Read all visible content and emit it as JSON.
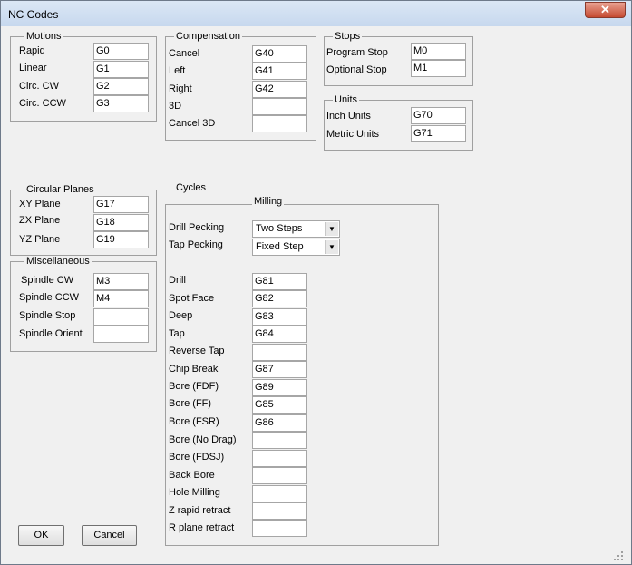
{
  "window": {
    "title": "NC Codes",
    "close_glyph": "✕"
  },
  "groups": {
    "motions": {
      "legend": "Motions",
      "rows": [
        {
          "label": "Rapid",
          "value": "G0"
        },
        {
          "label": "Linear",
          "value": "G1"
        },
        {
          "label": "Circ. CW",
          "value": "G2"
        },
        {
          "label": "Circ. CCW",
          "value": "G3"
        }
      ]
    },
    "compensation": {
      "legend": "Compensation",
      "rows": [
        {
          "label": "Cancel",
          "value": "G40"
        },
        {
          "label": "Left",
          "value": "G41"
        },
        {
          "label": "Right",
          "value": "G42"
        },
        {
          "label": "3D",
          "value": ""
        },
        {
          "label": "Cancel 3D",
          "value": ""
        }
      ]
    },
    "stops": {
      "legend": "Stops",
      "rows": [
        {
          "label": "Program Stop",
          "value": "M0"
        },
        {
          "label": "Optional Stop",
          "value": "M1"
        }
      ]
    },
    "units": {
      "legend": "Units",
      "rows": [
        {
          "label": "Inch Units",
          "value": "G70"
        },
        {
          "label": "Metric Units",
          "value": "G71"
        }
      ]
    },
    "circular_planes": {
      "legend": "Circular Planes",
      "rows": [
        {
          "label": "XY Plane",
          "value": "G17"
        },
        {
          "label": "ZX Plane",
          "value": "G18"
        },
        {
          "label": "YZ Plane",
          "value": "G19"
        }
      ]
    },
    "miscellaneous": {
      "legend": "Miscellaneous",
      "rows": [
        {
          "label": "Spindle CW",
          "value": "M3"
        },
        {
          "label": "Spindle CCW",
          "value": "M4"
        },
        {
          "label": "Spindle Stop",
          "value": ""
        },
        {
          "label": "Spindle Orient",
          "value": ""
        }
      ]
    },
    "cycles": {
      "label": "Cycles",
      "legend": "Milling",
      "combos": [
        {
          "label": "Drill Pecking",
          "value": "Two Steps"
        },
        {
          "label": "Tap Pecking",
          "value": "Fixed Step"
        }
      ],
      "rows": [
        {
          "label": "Drill",
          "value": "G81"
        },
        {
          "label": "Spot Face",
          "value": "G82"
        },
        {
          "label": "Deep",
          "value": "G83"
        },
        {
          "label": "Tap",
          "value": "G84"
        },
        {
          "label": "Reverse Tap",
          "value": ""
        },
        {
          "label": "Chip Break",
          "value": "G87"
        },
        {
          "label": "Bore (FDF)",
          "value": "G89"
        },
        {
          "label": "Bore (FF)",
          "value": "G85"
        },
        {
          "label": "Bore (FSR)",
          "value": "G86"
        },
        {
          "label": "Bore (No Drag)",
          "value": ""
        },
        {
          "label": "Bore (FDSJ)",
          "value": ""
        },
        {
          "label": "Back Bore",
          "value": ""
        },
        {
          "label": "Hole Milling",
          "value": ""
        },
        {
          "label": "Z rapid retract",
          "value": ""
        },
        {
          "label": "R plane retract",
          "value": ""
        }
      ]
    }
  },
  "buttons": {
    "ok": "OK",
    "cancel": "Cancel"
  }
}
